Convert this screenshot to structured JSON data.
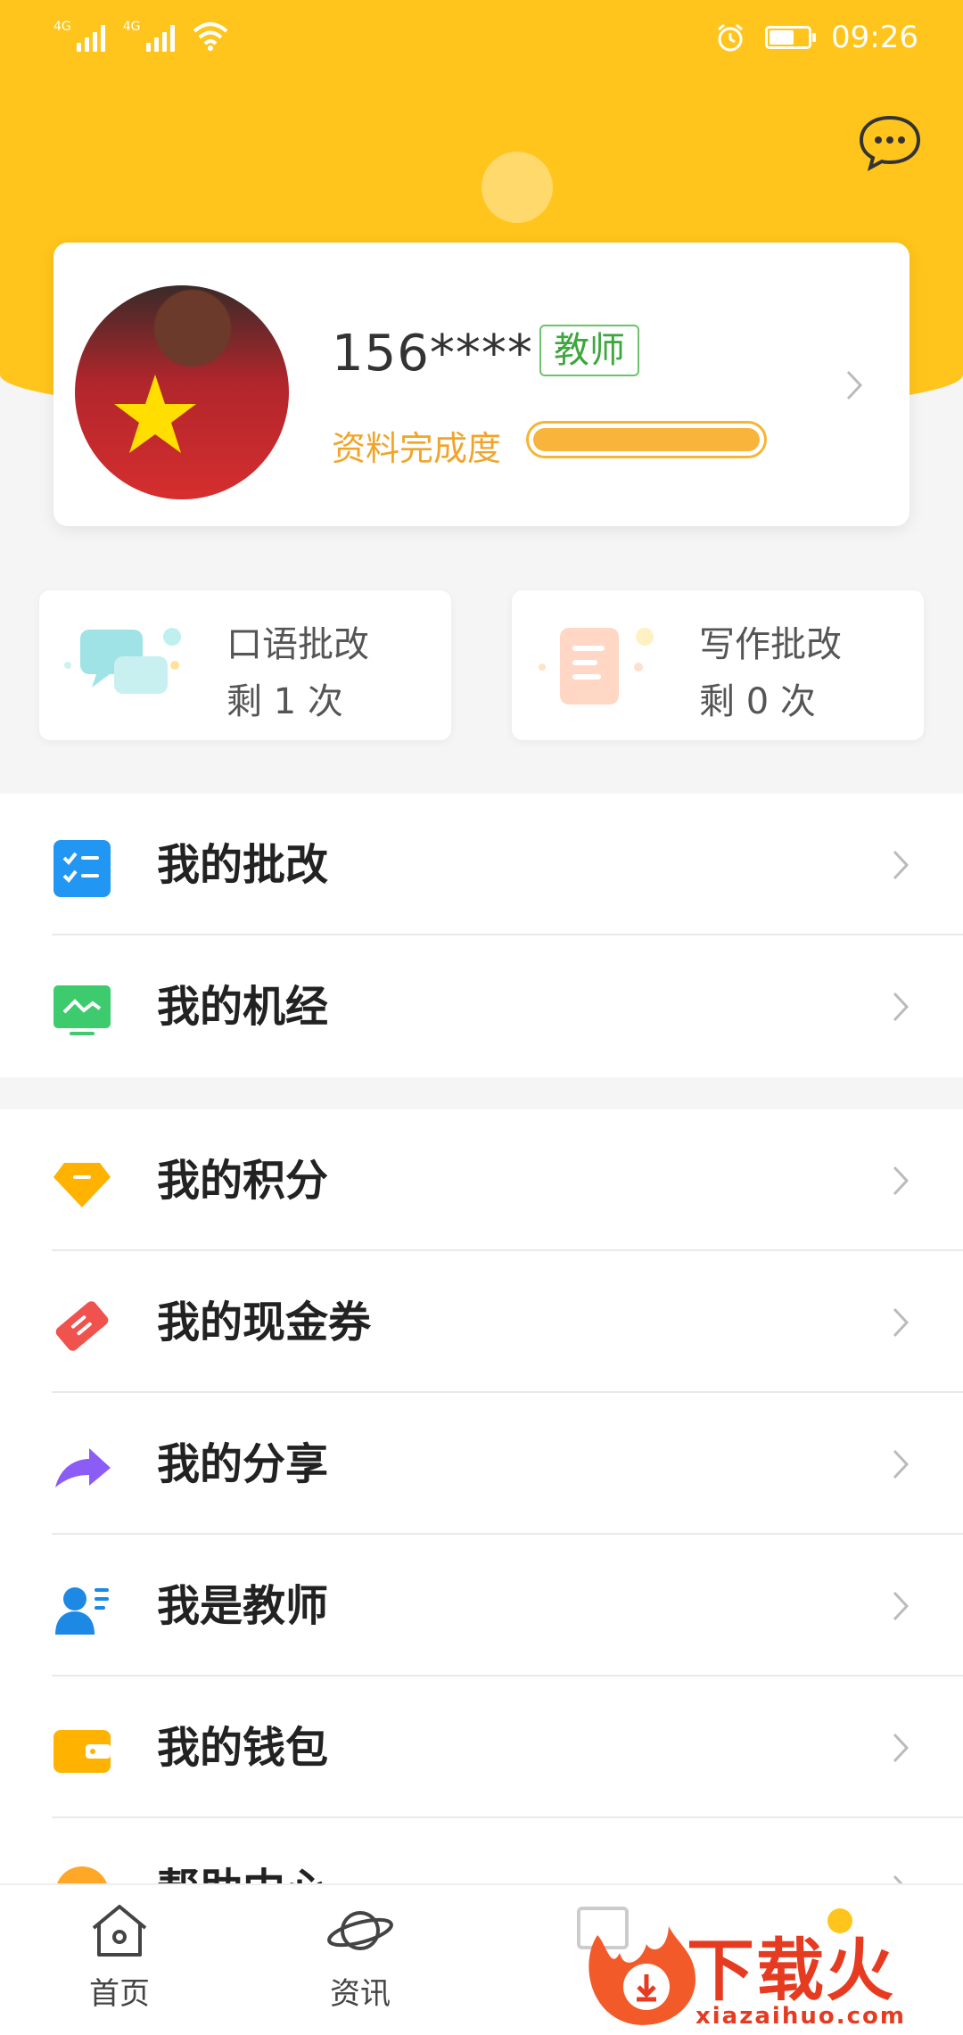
{
  "status_bar": {
    "network_1": "4G",
    "network_2": "4G",
    "time": "09:26"
  },
  "profile": {
    "username": "156****",
    "role_badge": "教师",
    "completion_label": "资料完成度",
    "completion_progress": 1.0
  },
  "stats": [
    {
      "title": "口语批改",
      "remaining": "剩 1 次"
    },
    {
      "title": "写作批改",
      "remaining": "剩 0 次"
    }
  ],
  "menu": {
    "group1": [
      {
        "label": "我的批改",
        "icon": "checklist-icon"
      },
      {
        "label": "我的机经",
        "icon": "monitor-icon"
      }
    ],
    "group2": [
      {
        "label": "我的积分",
        "icon": "diamond-icon"
      },
      {
        "label": "我的现金券",
        "icon": "ticket-icon"
      },
      {
        "label": "我的分享",
        "icon": "share-arrow-icon"
      },
      {
        "label": "我是教师",
        "icon": "teacher-icon"
      },
      {
        "label": "我的钱包",
        "icon": "wallet-icon"
      },
      {
        "label": "帮助中心",
        "icon": "help-icon"
      }
    ]
  },
  "tabbar": {
    "home": "首页",
    "news": "资讯"
  },
  "watermark": {
    "brand": "下载火",
    "url": "xiazaihuo.com"
  },
  "colors": {
    "brand_yellow": "#FFC51C",
    "badge_green": "#3da63d",
    "progress_orange": "#F9B43B",
    "watermark_red": "#E63B21"
  }
}
